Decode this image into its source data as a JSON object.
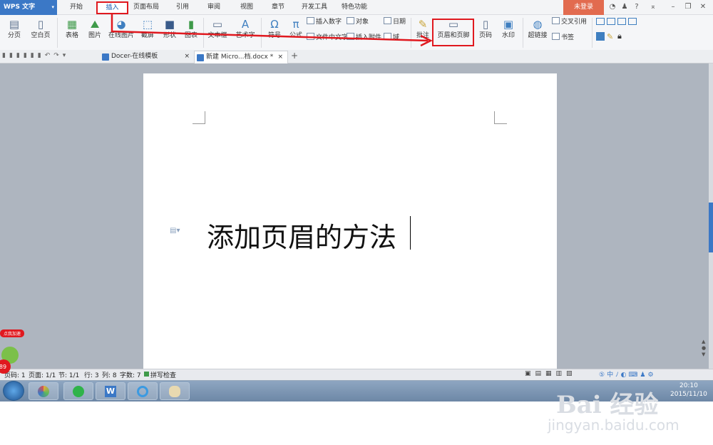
{
  "app": {
    "name": "WPS 文字",
    "login_label": "未登录"
  },
  "menu_tabs": [
    "开始",
    "插入",
    "页面布局",
    "引用",
    "审阅",
    "视图",
    "章节",
    "开发工具",
    "特色功能"
  ],
  "ribbon": {
    "page_break": "分页",
    "blank_page": "空白页",
    "table": "表格",
    "picture": "图片",
    "online_picture": "在线图片",
    "screenshot": "截屏",
    "shapes": "形状",
    "chart": "图表",
    "textbox": "文本框",
    "wordart": "艺术字",
    "symbol": "符号",
    "formula": "公式",
    "insert_number": "插入数字",
    "object": "对象",
    "date": "日期",
    "text_from_file": "文件中文字",
    "insert_attachment": "插入附件",
    "field": "域",
    "comment": "批注",
    "header_footer": "页眉和页脚",
    "page_number": "页码",
    "watermark": "水印",
    "hyperlink": "超链接",
    "cross_ref": "交叉引用",
    "bookmark": "书签"
  },
  "doc_tabs": [
    {
      "label": "Docer-在线模板",
      "close": "×"
    },
    {
      "label": "新建 Micro...档.docx *",
      "close": "×"
    }
  ],
  "new_tab": "+",
  "document": {
    "text": "添加页眉的方法"
  },
  "status": {
    "page_num": "页码: 1",
    "page": "页面: 1/1",
    "section": "节: 1/1",
    "row": "行: 3",
    "col": "列: 8",
    "chars": "字数: 7",
    "spell": "拼写检查"
  },
  "float_badge": {
    "label": "点我加速",
    "value": "89"
  },
  "taskbar": {
    "time": "20:10",
    "date": "2015/11/10"
  },
  "watermark": {
    "brand": "Bai 经验",
    "url": "jingyan.baidu.com"
  },
  "colors": {
    "accent": "#3b78c6",
    "annotation": "#e0191f",
    "login": "#e26b4f"
  }
}
